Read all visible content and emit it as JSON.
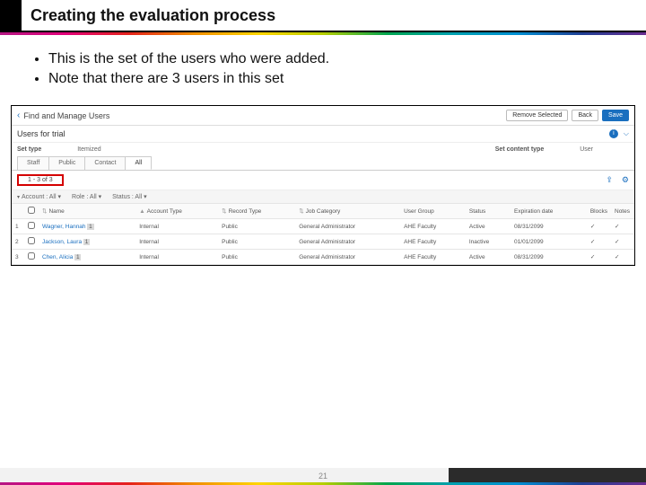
{
  "slide": {
    "title": "Creating the evaluation process",
    "bullets": [
      "This is the set of the users who were added.",
      "Note that there are 3 users in this set"
    ],
    "page_number": "21"
  },
  "app": {
    "page_title": "Find and Manage Users",
    "buttons": {
      "remove_selected": "Remove Selected",
      "back": "Back",
      "save": "Save"
    },
    "set_title": "Users for trial",
    "meta": {
      "set_type_label": "Set type",
      "set_type_value": "Itemized",
      "content_type_label": "Set content type",
      "content_type_value": "User"
    },
    "tabs": {
      "staff": "Staff",
      "public": "Public",
      "contact": "Contact",
      "all": "All"
    },
    "count": "1 - 3 of 3",
    "filters": {
      "account_label": "Account :",
      "account_value": "All",
      "role_label": "Role :",
      "role_value": "All",
      "status_label": "Status :",
      "status_value": "All"
    },
    "columns": {
      "name": "Name",
      "account_type": "Account Type",
      "record_type": "Record Type",
      "job_category": "Job Category",
      "user_group": "User Group",
      "status": "Status",
      "expiration": "Expiration date",
      "blocks": "Blocks",
      "notes": "Notes"
    },
    "rows": [
      {
        "idx": "1",
        "name": "Wagner, Hannah",
        "account_type": "Internal",
        "record_type": "Public",
        "job_category": "General Administrator",
        "user_group": "AHE Faculty",
        "status": "Active",
        "expiration": "08/31/2099"
      },
      {
        "idx": "2",
        "name": "Jackson, Laura",
        "account_type": "Internal",
        "record_type": "Public",
        "job_category": "General Administrator",
        "user_group": "AHE Faculty",
        "status": "Inactive",
        "expiration": "01/01/2099"
      },
      {
        "idx": "3",
        "name": "Chen, Alicia",
        "account_type": "Internal",
        "record_type": "Public",
        "job_category": "General Administrator",
        "user_group": "AHE Faculty",
        "status": "Active",
        "expiration": "08/31/2099"
      }
    ]
  }
}
